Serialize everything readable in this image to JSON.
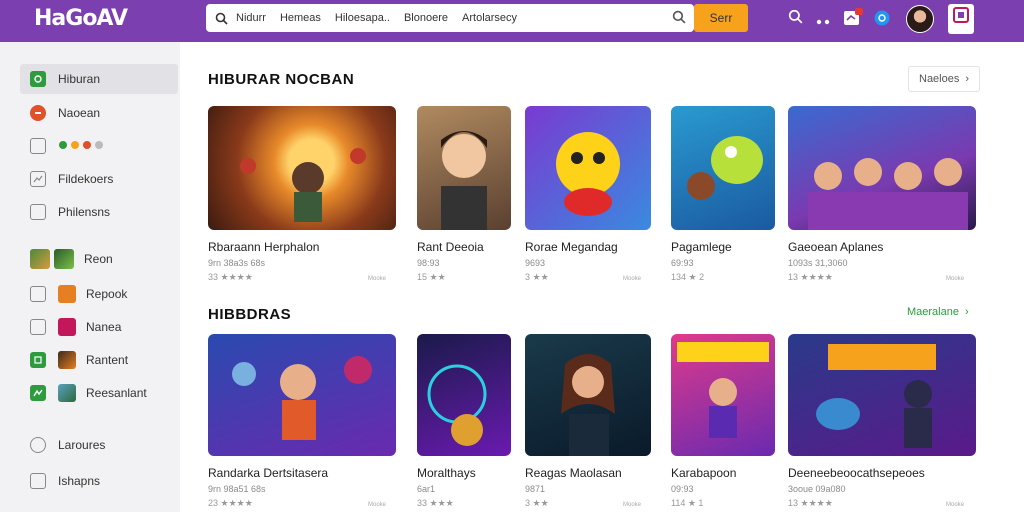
{
  "app": {
    "logo_text": "HaGoAV"
  },
  "search": {
    "terms": [
      "Nidurr",
      "Hemeas",
      "Hiloesapa..",
      "Blonoere",
      "Artolarsecy"
    ],
    "button_label": "Serr"
  },
  "sidebar": {
    "items": [
      {
        "label": "Hiburan",
        "icon": "game-icon",
        "color": "#2e9b3e"
      },
      {
        "label": "Naoean",
        "icon": "dot-icon",
        "color": "#e0502a"
      },
      {
        "label": "",
        "icon": "grid-icon",
        "color": "#888888"
      },
      {
        "label": "Fildekoers",
        "icon": "image-icon",
        "color": "#888888"
      },
      {
        "label": "Philensns",
        "icon": "chat-icon",
        "color": "#888888"
      },
      {
        "label": "Reon",
        "icon": "thumb-icon",
        "color": "#ff9800"
      },
      {
        "label": "Repook",
        "icon": "book-icon",
        "color": "#e67e22"
      },
      {
        "label": "Nanea",
        "icon": "media-icon",
        "color": "#c2185b"
      },
      {
        "label": "Rantent",
        "icon": "app-icon",
        "color": "#2e9b3e"
      },
      {
        "label": "Reesanlant",
        "icon": "puzzle-icon",
        "color": "#2e9b3e"
      },
      {
        "label": "Laroures",
        "icon": "settings-icon",
        "color": "#888888"
      },
      {
        "label": "Ishapns",
        "icon": "info-icon",
        "color": "#888888"
      }
    ]
  },
  "sections": [
    {
      "title": "HIBURAR NOCBAN",
      "more_label": "Naeloes",
      "cards": [
        {
          "name": "Rbaraann Herphalon",
          "sub": "9rn 38a3s 68s",
          "stars": "33 ★★★★",
          "tag": "Mooke"
        },
        {
          "name": "Rant Deeoia",
          "sub": "98:93",
          "stars": "15 ★★",
          "tag": ""
        },
        {
          "name": "Rorae Megandag",
          "sub": "9693",
          "stars": "3 ★★",
          "tag": "Mooke"
        },
        {
          "name": "Pagamlege",
          "sub": "69:93",
          "stars": "134 ★ 2",
          "tag": ""
        },
        {
          "name": "Gaeoean Aplanes",
          "sub": "1093s 31,3060",
          "stars": "13 ★★★★",
          "tag": "Mooke"
        }
      ]
    },
    {
      "title": "HIBBDRAS",
      "more_label": "Maeralane",
      "cards": [
        {
          "name": "Randarka Dertsitasera",
          "sub": "9rn 98a51 68s",
          "stars": "23 ★★★★",
          "tag": "Mooke"
        },
        {
          "name": "Moralthays",
          "sub": "6ar1",
          "stars": "33 ★★★",
          "tag": ""
        },
        {
          "name": "Reagas Maolasan",
          "sub": "9871",
          "stars": "3 ★★",
          "tag": "Mooke"
        },
        {
          "name": "Karabapoon",
          "sub": "09:93",
          "stars": "114 ★ 1",
          "tag": ""
        },
        {
          "name": "Deeneebeoocathsepeoes",
          "sub": "3ooue 09a080",
          "stars": "13 ★★★★",
          "tag": "Mooke"
        }
      ]
    }
  ],
  "colors": {
    "topbar": "#7b3fb0",
    "search_button": "#f6a21c",
    "more_green": "#2e9b3e"
  }
}
